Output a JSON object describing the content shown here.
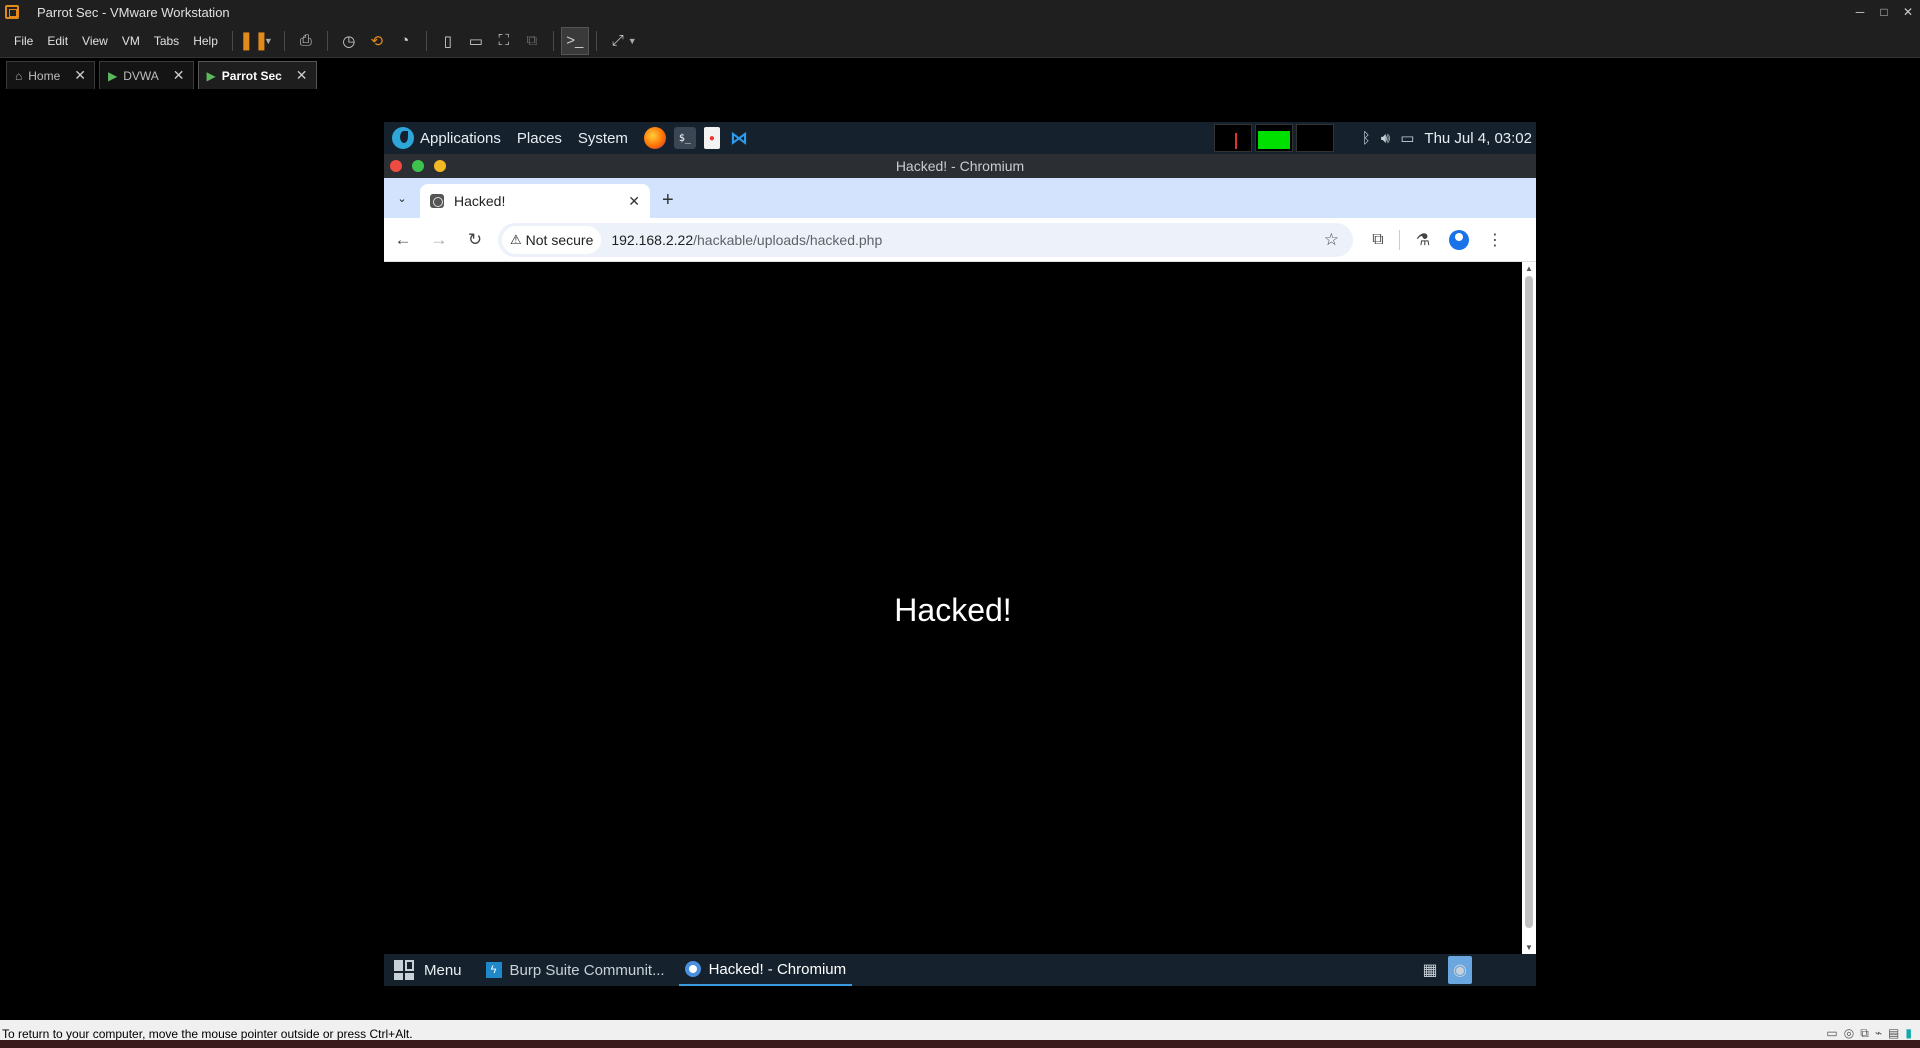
{
  "host": {
    "title": "Parrot Sec - VMware Workstation",
    "menu": [
      "File",
      "Edit",
      "View",
      "VM",
      "Tabs",
      "Help"
    ],
    "tabs": [
      {
        "label": "Home"
      },
      {
        "label": "DVWA"
      },
      {
        "label": "Parrot Sec"
      }
    ],
    "status_text": "To return to your computer, move the mouse pointer outside or press Ctrl+Alt."
  },
  "guest_panel": {
    "menus": [
      "Applications",
      "Places",
      "System"
    ],
    "clock": "Thu Jul 4, 03:02"
  },
  "chromium": {
    "window_title": "Hacked! - Chromium",
    "tab_title": "Hacked!",
    "security_label": "Not secure",
    "url_host": "192.168.2.22",
    "url_path": "/hackable/uploads/hacked.php",
    "page_text": "Hacked!"
  },
  "guest_taskbar": {
    "menu_label": "Menu",
    "items": [
      {
        "label": "Burp Suite Communit..."
      },
      {
        "label": "Hacked! - Chromium"
      }
    ]
  },
  "icons": {
    "accent": "#e48a1a",
    "panel_bg": "#15222e",
    "tabstrip_bg": "#d3e3fd"
  }
}
